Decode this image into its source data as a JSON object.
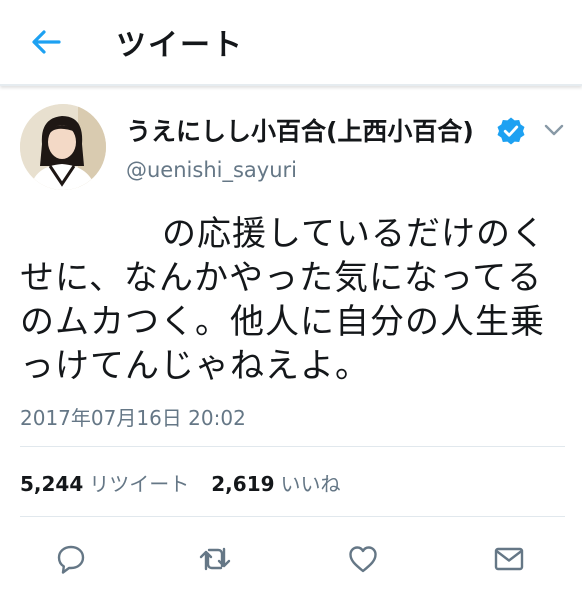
{
  "header": {
    "title": "ツイート",
    "back_icon": "arrow-left-icon"
  },
  "colors": {
    "accent": "#1da1f2",
    "text": "#14171a",
    "secondary": "#657786",
    "divider": "#e1e8ed"
  },
  "tweet": {
    "display_name": "うえにしし小百合(上西小百合)",
    "handle": "@uenishi_sayuri",
    "verified": true,
    "text_lines": [
      "の応援しているだけのく",
      "せに、なんかやった気になってる",
      "のムカつく。他人に自分の人生乗",
      "っけてんじゃねえよ。"
    ],
    "timestamp": "2017年07月16日 20:02",
    "retweet_count": "5,244",
    "retweet_label": "リツイート",
    "like_count": "2,619",
    "like_label": "いいね"
  },
  "actions": [
    {
      "icon": "reply-icon"
    },
    {
      "icon": "retweet-icon"
    },
    {
      "icon": "heart-icon"
    },
    {
      "icon": "envelope-icon"
    }
  ]
}
